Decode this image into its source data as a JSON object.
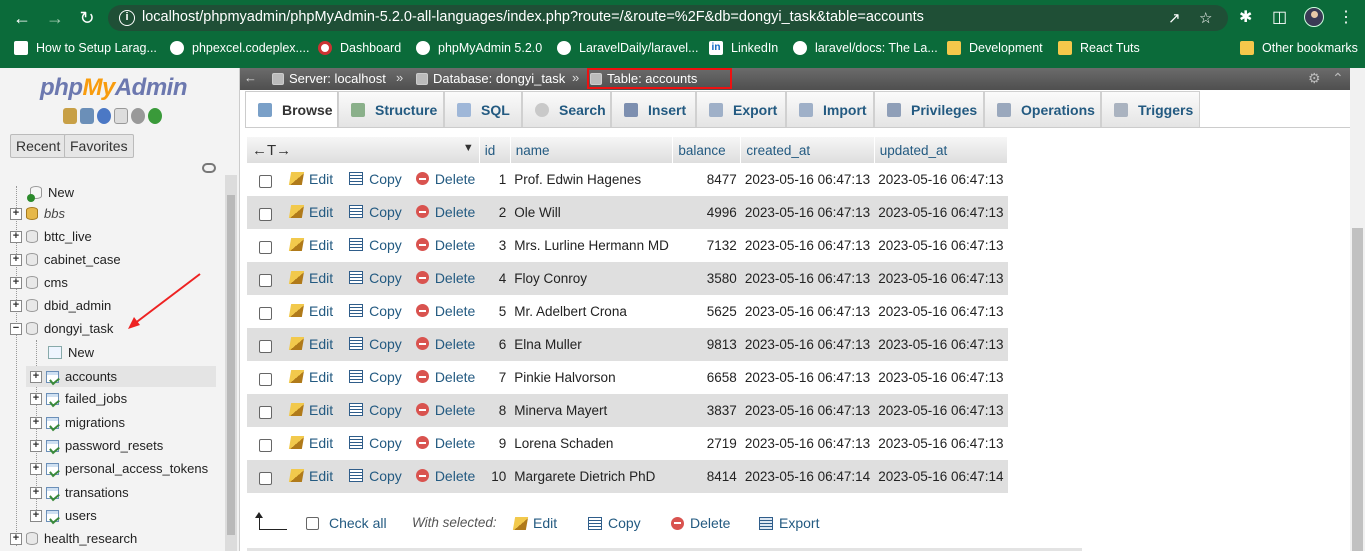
{
  "browser": {
    "url": "localhost/phpmyadmin/phpMyAdmin-5.2.0-all-languages/index.php?route=/&route=%2F&db=dongyi_task&table=accounts",
    "bookmarks": [
      {
        "label": "How to Setup Larag...",
        "icon": "doc-icon"
      },
      {
        "label": "phpexcel.codeplex....",
        "icon": "globe-icon"
      },
      {
        "label": "Dashboard",
        "icon": "dashboard-icon"
      },
      {
        "label": "phpMyAdmin 5.2.0",
        "icon": "globe-icon"
      },
      {
        "label": "LaravelDaily/laravel...",
        "icon": "github-icon"
      },
      {
        "label": "LinkedIn",
        "icon": "linkedin-icon"
      },
      {
        "label": "laravel/docs: The La...",
        "icon": "github-icon"
      },
      {
        "label": "Development",
        "icon": "folder-icon"
      },
      {
        "label": "React Tuts",
        "icon": "folder-icon"
      },
      {
        "label": "Other bookmarks",
        "icon": "folder-icon"
      }
    ],
    "chrome_color": "#0b6b3a"
  },
  "sidebar": {
    "logo_php": "php",
    "logo_my": "My",
    "logo_admin": "Admin",
    "recent_label": "Recent",
    "favorites_label": "Favorites",
    "new_label": "New",
    "databases": [
      {
        "name": "bbs"
      },
      {
        "name": "bttc_live"
      },
      {
        "name": "cabinet_case"
      },
      {
        "name": "cms"
      },
      {
        "name": "dbid_admin"
      },
      {
        "name": "dongyi_task"
      },
      {
        "name": "health_research"
      }
    ],
    "dongyi_new_label": "New",
    "tables": [
      {
        "name": "accounts"
      },
      {
        "name": "failed_jobs"
      },
      {
        "name": "migrations"
      },
      {
        "name": "password_resets"
      },
      {
        "name": "personal_access_tokens"
      },
      {
        "name": "transations"
      },
      {
        "name": "users"
      }
    ]
  },
  "breadcrumb": {
    "server": "Server: localhost",
    "database": "Database: dongyi_task",
    "table": "Table: accounts",
    "separator": "»"
  },
  "tabs": [
    {
      "label": "Browse",
      "icon": "browse-icon"
    },
    {
      "label": "Structure",
      "icon": "structure-icon"
    },
    {
      "label": "SQL",
      "icon": "sql-icon"
    },
    {
      "label": "Search",
      "icon": "search-icon"
    },
    {
      "label": "Insert",
      "icon": "insert-icon"
    },
    {
      "label": "Export",
      "icon": "export-icon"
    },
    {
      "label": "Import",
      "icon": "import-icon"
    },
    {
      "label": "Privileges",
      "icon": "privileges-icon"
    },
    {
      "label": "Operations",
      "icon": "operations-icon"
    },
    {
      "label": "Triggers",
      "icon": "triggers-icon"
    }
  ],
  "grid": {
    "sort_arrows": "←T→",
    "columns": [
      "id",
      "name",
      "balance",
      "created_at",
      "updated_at"
    ],
    "action_edit": "Edit",
    "action_copy": "Copy",
    "action_delete": "Delete",
    "rows": [
      {
        "id": "1",
        "name": "Prof. Edwin Hagenes",
        "balance": "8477",
        "created_at": "2023-05-16 06:47:13",
        "updated_at": "2023-05-16 06:47:13"
      },
      {
        "id": "2",
        "name": "Ole Will",
        "balance": "4996",
        "created_at": "2023-05-16 06:47:13",
        "updated_at": "2023-05-16 06:47:13"
      },
      {
        "id": "3",
        "name": "Mrs. Lurline Hermann MD",
        "balance": "7132",
        "created_at": "2023-05-16 06:47:13",
        "updated_at": "2023-05-16 06:47:13"
      },
      {
        "id": "4",
        "name": "Floy Conroy",
        "balance": "3580",
        "created_at": "2023-05-16 06:47:13",
        "updated_at": "2023-05-16 06:47:13"
      },
      {
        "id": "5",
        "name": "Mr. Adelbert Crona",
        "balance": "5625",
        "created_at": "2023-05-16 06:47:13",
        "updated_at": "2023-05-16 06:47:13"
      },
      {
        "id": "6",
        "name": "Elna Muller",
        "balance": "9813",
        "created_at": "2023-05-16 06:47:13",
        "updated_at": "2023-05-16 06:47:13"
      },
      {
        "id": "7",
        "name": "Pinkie Halvorson",
        "balance": "6658",
        "created_at": "2023-05-16 06:47:13",
        "updated_at": "2023-05-16 06:47:13"
      },
      {
        "id": "8",
        "name": "Minerva Mayert",
        "balance": "3837",
        "created_at": "2023-05-16 06:47:13",
        "updated_at": "2023-05-16 06:47:13"
      },
      {
        "id": "9",
        "name": "Lorena Schaden",
        "balance": "2719",
        "created_at": "2023-05-16 06:47:13",
        "updated_at": "2023-05-16 06:47:13"
      },
      {
        "id": "10",
        "name": "Margarete Dietrich PhD",
        "balance": "8414",
        "created_at": "2023-05-16 06:47:14",
        "updated_at": "2023-05-16 06:47:14"
      }
    ]
  },
  "footer": {
    "check_all": "Check all",
    "with_selected": "With selected:",
    "edit": "Edit",
    "copy": "Copy",
    "delete": "Delete",
    "export": "Export"
  }
}
